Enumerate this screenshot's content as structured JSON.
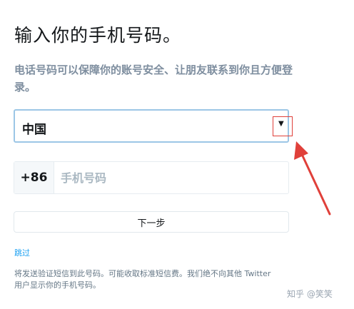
{
  "header": {
    "title": "输入你的手机号码。",
    "subtitle": "电话号码可以保障你的账号安全、让朋友联系到你且方便登录。"
  },
  "country_select": {
    "value": "中国",
    "caret": "▼"
  },
  "phone": {
    "prefix": "+86",
    "placeholder": "手机号码"
  },
  "buttons": {
    "next": "下一步",
    "skip": "跳过"
  },
  "footer": {
    "disclaimer": "将发送验证短信到此号码。可能收取标准短信费。我们绝不向其他 Twitter 用户显示你的手机号码。",
    "watermark": "知乎 @笑笑"
  },
  "annotation": {
    "highlight_color": "#e0403a"
  }
}
